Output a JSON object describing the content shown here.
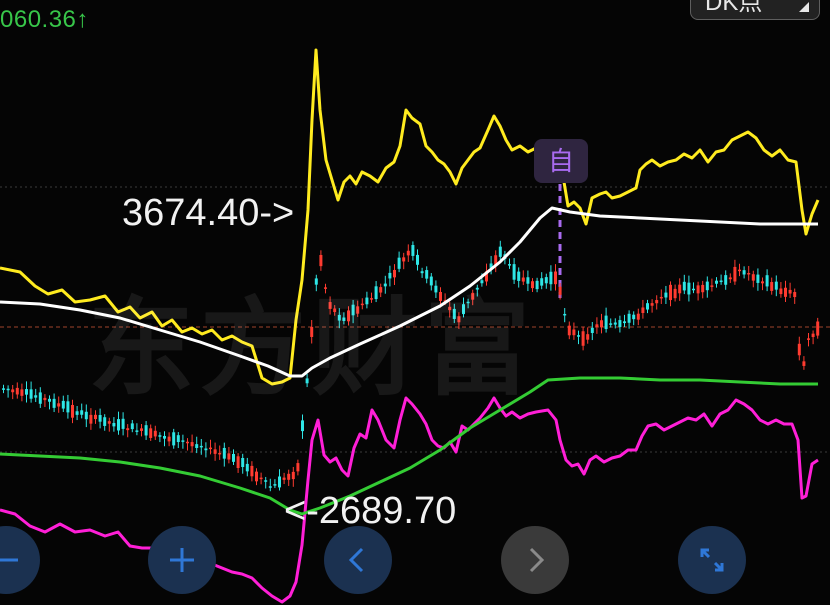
{
  "header": {
    "price_change": "060.36↑",
    "dk_button_label": "DK点"
  },
  "chart": {
    "watermark": "东方财富",
    "high_label": "3674.40->",
    "low_label": "<-2689.70",
    "event_tag": "自",
    "colors": {
      "background": "#050505",
      "up": "#ff3b30",
      "down": "#2ee6e6",
      "upper_band": "#ffeb1f",
      "lower_band": "#ff1fd7",
      "mid_line": "#ffffff",
      "long_ma": "#34cc34",
      "event_marker": "#a96bf0",
      "reference_line": "#ff6040",
      "price_rise_text": "#38c64a"
    }
  },
  "controls": [
    {
      "name": "zoom-out",
      "icon": "minus-icon"
    },
    {
      "name": "zoom-in",
      "icon": "plus-icon"
    },
    {
      "name": "scroll-left",
      "icon": "chevron-left-icon"
    },
    {
      "name": "scroll-right",
      "icon": "chevron-right-icon"
    },
    {
      "name": "fullscreen",
      "icon": "expand-icon"
    }
  ]
}
